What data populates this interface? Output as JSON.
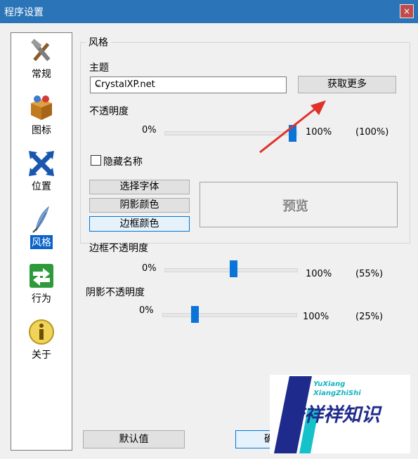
{
  "window": {
    "title": "程序设置",
    "close_glyph": "×"
  },
  "sidebar": {
    "items": [
      {
        "label": "常规",
        "icon": "tools-icon"
      },
      {
        "label": "图标",
        "icon": "box-icon"
      },
      {
        "label": "位置",
        "icon": "cross-arrows-icon"
      },
      {
        "label": "风格",
        "icon": "feather-icon",
        "selected": true
      },
      {
        "label": "行为",
        "icon": "exchange-arrows-icon"
      },
      {
        "label": "关于",
        "icon": "info-icon"
      }
    ]
  },
  "style_group": {
    "legend": "风格",
    "theme_label": "主题",
    "theme_value": "CrystalXP.net",
    "get_more_button": "获取更多",
    "opacity_label": "不透明度",
    "opacity": {
      "min": "0%",
      "max": "100%",
      "value": "(100%)",
      "fraction": 1.0
    },
    "hide_name_label": "隐藏名称",
    "hide_name_checked": false,
    "font_button": "选择字体",
    "shadow_color_button": "阴影颜色",
    "border_color_button": "边框颜色",
    "preview_text": "预览",
    "border_opacity_label": "边框不透明度",
    "border_opacity": {
      "min": "0%",
      "max": "100%",
      "value": "(55%)",
      "fraction": 0.55
    },
    "shadow_opacity_label": "阴影不透明度",
    "shadow_opacity": {
      "min": "0%",
      "max": "100%",
      "value": "(25%)",
      "fraction": 0.25
    }
  },
  "footer": {
    "default_button": "默认值",
    "ok_button_partial": "确"
  },
  "colors": {
    "titlebar": "#2b74b8",
    "accent": "#0a74d8",
    "annotation_arrow": "#e0312c"
  },
  "watermark": {
    "line1": "YuXiang",
    "line2": "XiangZhiShi",
    "brand": "誉祥祥知识"
  }
}
